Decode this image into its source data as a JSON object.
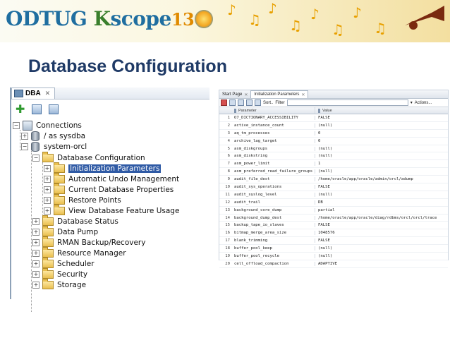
{
  "banner": {
    "brand_a": "ODTUG",
    "brand_k": "K",
    "brand_b": "scope",
    "brand_num": "13"
  },
  "slide": {
    "title": "Database Configuration"
  },
  "dba": {
    "tab_label": "DBA",
    "tree": {
      "connections": "Connections",
      "as_sysdba": "/ as sysdba",
      "system_orcl": "system-orcl",
      "database_configuration": "Database Configuration",
      "config_children": [
        "Initialization Parameters",
        "Automatic Undo Management",
        "Current Database Properties",
        "Restore Points",
        "View Database Feature Usage"
      ],
      "other_nodes": [
        "Database Status",
        "Data Pump",
        "RMAN Backup/Recovery",
        "Resource Manager",
        "Scheduler",
        "Security",
        "Storage"
      ]
    }
  },
  "params_panel": {
    "tabs": [
      "Start Page",
      "Initialization Parameters"
    ],
    "toolbar": {
      "sort": "Sort..",
      "filter": "Filter",
      "actions": "Actions..."
    },
    "columns": [
      "Parameter",
      "Value"
    ],
    "rows": [
      {
        "n": "1",
        "p": "O7_DICTIONARY_ACCESSIBILITY",
        "v": "FALSE"
      },
      {
        "n": "2",
        "p": "active_instance_count",
        "v": "(null)"
      },
      {
        "n": "3",
        "p": "aq_tm_processes",
        "v": "0"
      },
      {
        "n": "4",
        "p": "archive_lag_target",
        "v": "0"
      },
      {
        "n": "5",
        "p": "asm_diskgroups",
        "v": "(null)"
      },
      {
        "n": "6",
        "p": "asm_diskstring",
        "v": "(null)"
      },
      {
        "n": "7",
        "p": "asm_power_limit",
        "v": "1"
      },
      {
        "n": "8",
        "p": "asm_preferred_read_failure_groups",
        "v": "(null)"
      },
      {
        "n": "9",
        "p": "audit_file_dest",
        "v": "/home/oracle/app/oracle/admin/orcl/adump"
      },
      {
        "n": "10",
        "p": "audit_sys_operations",
        "v": "FALSE"
      },
      {
        "n": "11",
        "p": "audit_syslog_level",
        "v": "(null)"
      },
      {
        "n": "12",
        "p": "audit_trail",
        "v": "DB"
      },
      {
        "n": "13",
        "p": "background_core_dump",
        "v": "partial"
      },
      {
        "n": "14",
        "p": "background_dump_dest",
        "v": "/home/oracle/app/oracle/diag/rdbms/orcl/orcl/trace"
      },
      {
        "n": "15",
        "p": "backup_tape_io_slaves",
        "v": "FALSE"
      },
      {
        "n": "16",
        "p": "bitmap_merge_area_size",
        "v": "1048576"
      },
      {
        "n": "17",
        "p": "blank_trimming",
        "v": "FALSE"
      },
      {
        "n": "18",
        "p": "buffer_pool_keep",
        "v": "(null)"
      },
      {
        "n": "19",
        "p": "buffer_pool_recycle",
        "v": "(null)"
      },
      {
        "n": "20",
        "p": "cell_offload_compaction",
        "v": "ADAPTIVE"
      }
    ]
  }
}
